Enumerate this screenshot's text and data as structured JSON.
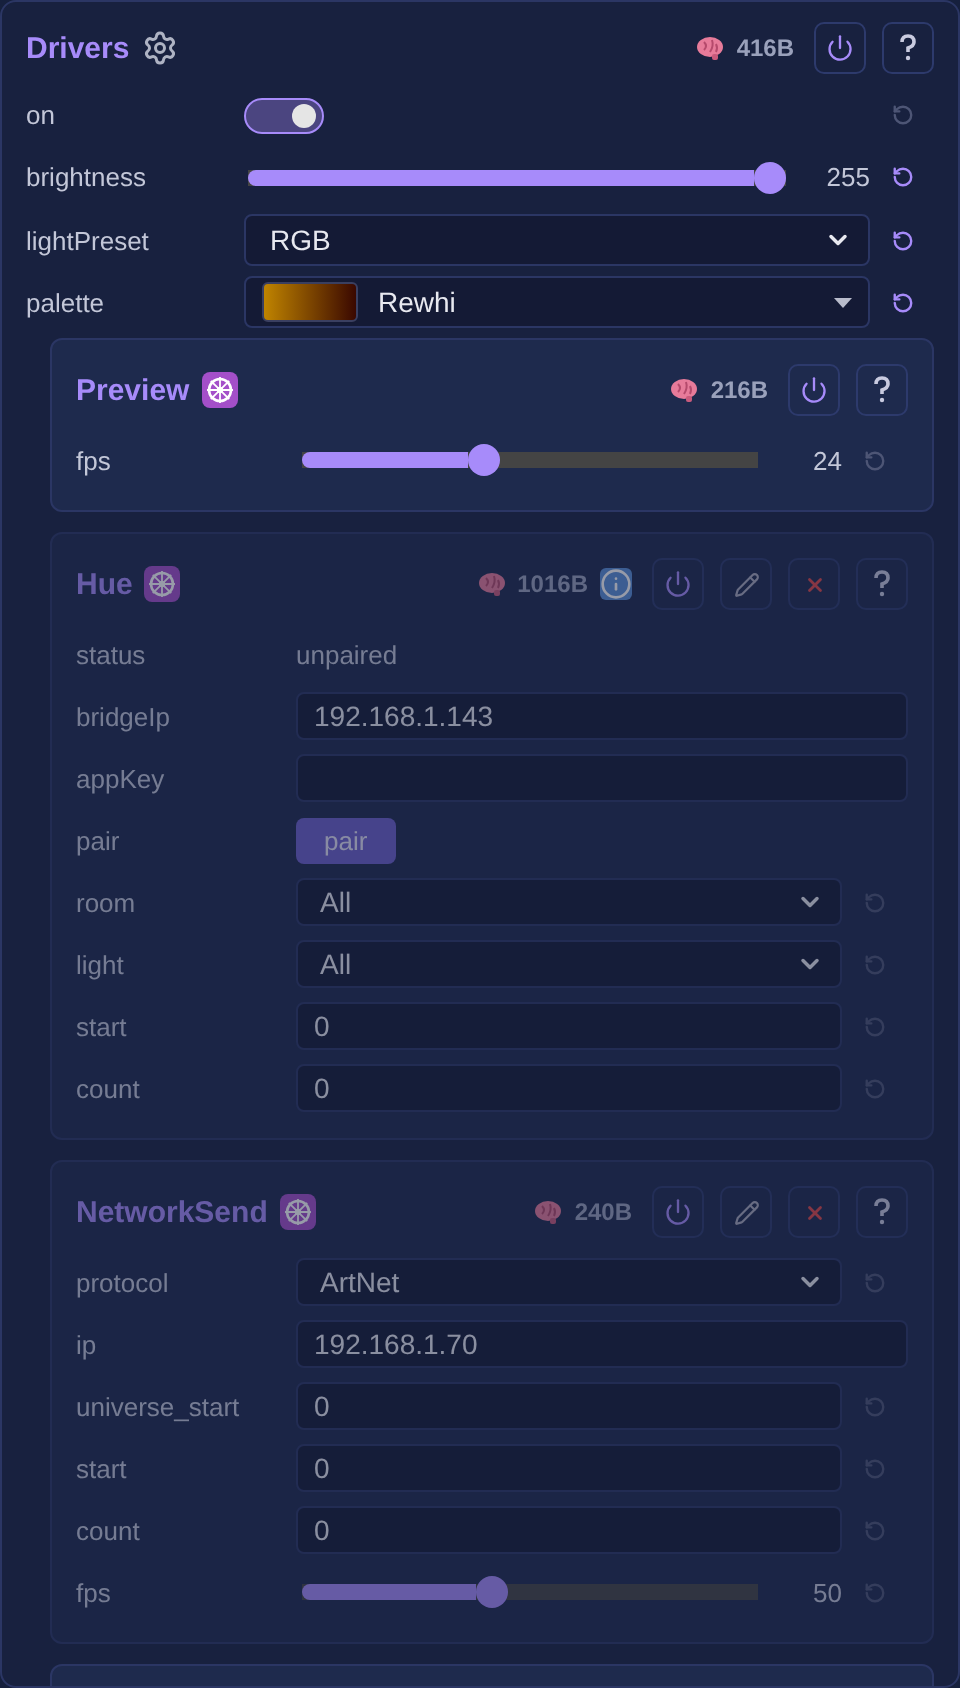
{
  "header": {
    "title": "Drivers",
    "memory": "416B",
    "power": true,
    "help": true
  },
  "controls": [
    {
      "kind": "toggle",
      "label": "on",
      "on": true,
      "reset": true,
      "changed": false
    },
    {
      "kind": "slider",
      "label": "brightness",
      "level": 1,
      "reading": "255",
      "reset": true,
      "changed": true
    },
    {
      "kind": "select",
      "label": "lightPreset",
      "value": "RGB",
      "reset": true,
      "changed": true
    },
    {
      "kind": "palette",
      "label": "palette",
      "value": "Rewhi",
      "reset": true,
      "changed": true
    }
  ],
  "modules": [
    {
      "title": "Preview",
      "memory": "216B",
      "disabled": false,
      "power": true,
      "help": true,
      "controls": [
        {
          "kind": "slider",
          "label": "fps",
          "level": 0.39,
          "reading": "24",
          "reset": true,
          "changed": false
        }
      ]
    },
    {
      "title": "Hue",
      "memory": "1016B",
      "info": true,
      "disabled": true,
      "power": true,
      "edit": true,
      "delete": true,
      "help": true,
      "controls": [
        {
          "kind": "text",
          "label": "status",
          "value": "unpaired"
        },
        {
          "kind": "input",
          "label": "bridgeIp",
          "value": "192.168.1.143"
        },
        {
          "kind": "input",
          "label": "appKey"
        },
        {
          "kind": "button",
          "label": "pair",
          "value": "pair"
        },
        {
          "kind": "select",
          "label": "room",
          "value": "All",
          "reset": true,
          "changed": false
        },
        {
          "kind": "select",
          "label": "light",
          "value": "All",
          "reset": true,
          "changed": false
        },
        {
          "kind": "input",
          "label": "start",
          "value": "0",
          "reset": true,
          "changed": false
        },
        {
          "kind": "input",
          "label": "count",
          "value": "0",
          "reset": true,
          "changed": false
        }
      ]
    },
    {
      "title": "NetworkSend",
      "memory": "240B",
      "disabled": true,
      "power": true,
      "edit": true,
      "delete": true,
      "help": true,
      "controls": [
        {
          "kind": "select",
          "label": "protocol",
          "value": "ArtNet",
          "reset": true,
          "changed": false
        },
        {
          "kind": "input",
          "label": "ip",
          "value": "192.168.1.70"
        },
        {
          "kind": "input",
          "label": "universe_start",
          "value": "0",
          "reset": true,
          "changed": false
        },
        {
          "kind": "input",
          "label": "start",
          "value": "0",
          "reset": true,
          "changed": false
        },
        {
          "kind": "input",
          "label": "count",
          "value": "0",
          "reset": true,
          "changed": false
        },
        {
          "kind": "slider",
          "label": "fps",
          "level": 0.41,
          "reading": "50",
          "reset": true,
          "changed": false
        }
      ]
    }
  ]
}
